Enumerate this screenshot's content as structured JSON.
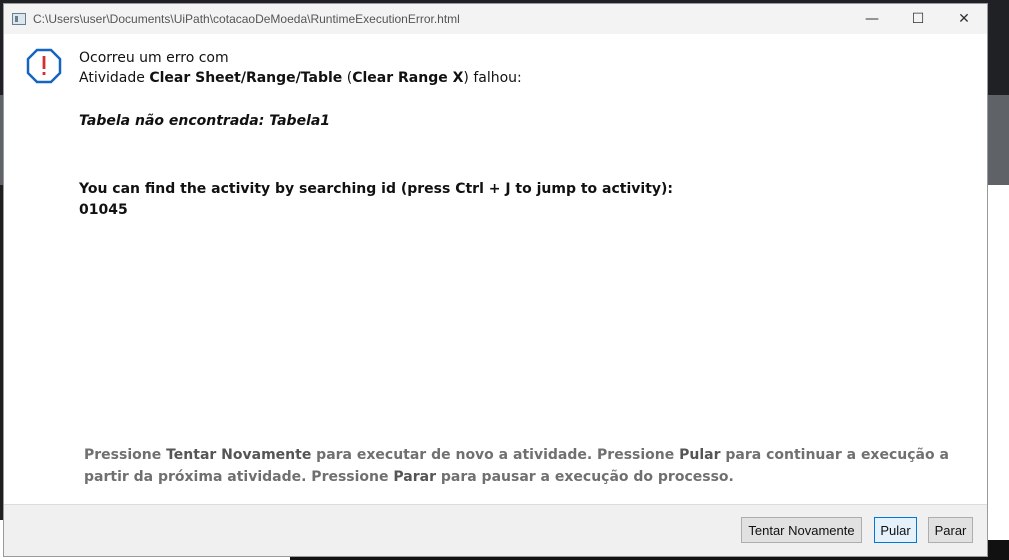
{
  "window": {
    "title": "C:\\Users\\user\\Documents\\UiPath\\cotacaoDeMoeda\\RuntimeExecutionError.html",
    "controls": {
      "minimize": "—",
      "maximize": "☐",
      "close": "✕"
    }
  },
  "error": {
    "heading": "Ocorreu um erro com",
    "activity_prefix": "Atividade ",
    "activity_name": "Clear Sheet/Range/Table",
    "activity_paren_open": " (",
    "activity_display": "Clear Range X",
    "activity_suffix": ") falhou:",
    "detail": "Tabela não encontrada: Tabela1",
    "find_text": "You can find the activity by searching id (press Ctrl + J to jump to activity):",
    "activity_id": "01045"
  },
  "instructions": {
    "p1": "Pressione ",
    "retry_word": "Tentar Novamente",
    "p2": " para executar de novo a atividade. Pressione ",
    "skip_word": "Pular",
    "p3": " para continuar a execução a partir da próxima atividade. Pressione ",
    "stop_word": "Parar",
    "p4": " para pausar a execução do processo."
  },
  "buttons": {
    "retry": "Tentar Novamente",
    "skip": "Pular",
    "stop": "Parar"
  },
  "colors": {
    "error_icon": "#1565c0",
    "error_mark": "#d32f2f",
    "focus_border": "#0078d7"
  }
}
